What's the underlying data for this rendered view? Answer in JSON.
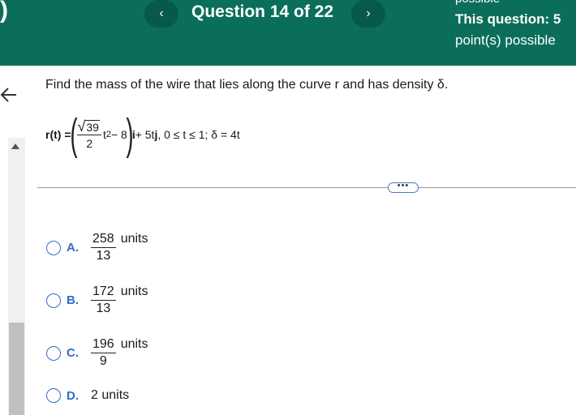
{
  "header": {
    "left_glyph": ")",
    "prev_label": "‹",
    "next_label": "›",
    "title": "Question 14 of 22",
    "points_clipped": "possible",
    "points_line1": "This question: 5",
    "points_line2": "point(s) possible"
  },
  "question": {
    "prompt": "Find the mass of the wire that lies along the curve r and has density δ.",
    "formula": {
      "lhs": "r(t) =",
      "sqrt_sym": "√",
      "sqrt_arg": "39",
      "den": "2",
      "tpow": "t",
      "exp": "2",
      "minus8": " − 8",
      "ivec": "i",
      "rest_a": " + 5t",
      "jvec": "j",
      "rest_b": ", 0 ≤ t ≤ 1; δ = 4t"
    }
  },
  "more_button": "•••",
  "choices": [
    {
      "letter": "A.",
      "num": "258",
      "den": "13",
      "unit": "units"
    },
    {
      "letter": "B.",
      "num": "172",
      "den": "13",
      "unit": "units"
    },
    {
      "letter": "C.",
      "num": "196",
      "den": "9",
      "unit": "units"
    },
    {
      "letter": "D.",
      "text": "2 units"
    }
  ]
}
